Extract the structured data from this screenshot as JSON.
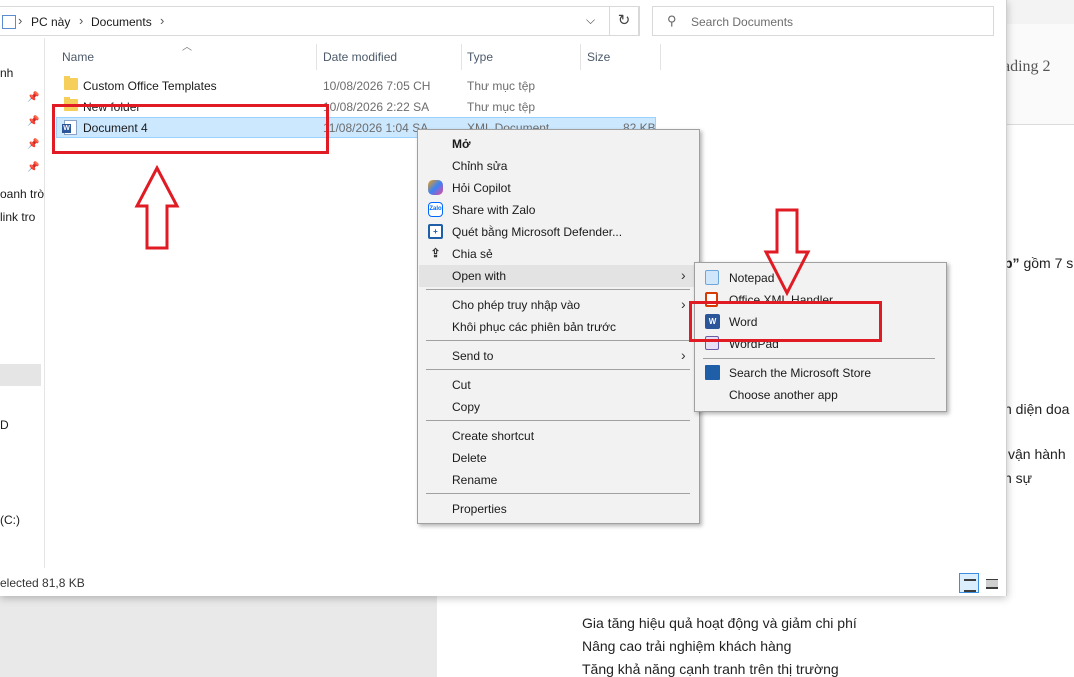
{
  "explorer": {
    "breadcrumb": [
      "PC này",
      "Documents"
    ],
    "search_placeholder": "Search Documents",
    "nav_items": [
      "nh",
      "oanh trò",
      "link tro",
      "D",
      "(C:)"
    ],
    "columns": {
      "name": "Name",
      "date": "Date modified",
      "type": "Type",
      "size": "Size"
    },
    "files": [
      {
        "name": "Custom Office Templates",
        "date": "10/08/2026 7:05 CH",
        "type": "Thư mục tệp",
        "size": "",
        "icon": "folder-icon"
      },
      {
        "name": "New folder",
        "date": "10/08/2026 2:22 SA",
        "type": "Thư mục tệp",
        "size": "",
        "icon": "folder-icon"
      },
      {
        "name": "Document 4",
        "date": "11/08/2026 1:04 SA",
        "type": "XML Document",
        "size": "82 KB",
        "icon": "word-xml-icon"
      }
    ],
    "status": "elected  81,8 KB"
  },
  "context_menu": {
    "items": [
      {
        "label": "Mở",
        "bold": true
      },
      {
        "label": "Chỉnh sửa"
      },
      {
        "label": "Hỏi Copilot",
        "icon": "copilot-icon"
      },
      {
        "label": "Share with Zalo",
        "icon": "zalo-icon"
      },
      {
        "label": "Quét bằng Microsoft Defender...",
        "icon": "defender-icon"
      },
      {
        "label": "Chia sẻ",
        "icon": "share-icon"
      },
      {
        "label": "Open with",
        "submenu": true
      },
      {
        "label": "Cho phép truy nhập vào",
        "submenu": true
      },
      {
        "label": "Khôi phục các phiên bản trước"
      },
      {
        "label": "Send to",
        "submenu": true
      },
      {
        "label": "Cut"
      },
      {
        "label": "Copy"
      },
      {
        "label": "Create shortcut"
      },
      {
        "label": "Delete"
      },
      {
        "label": "Rename"
      },
      {
        "label": "Properties"
      }
    ]
  },
  "open_with_menu": {
    "items": [
      {
        "label": "Notepad",
        "icon": "notepad-icon"
      },
      {
        "label": "Office XML Handler",
        "icon": "office-icon"
      },
      {
        "label": "Word",
        "icon": "word-icon"
      },
      {
        "label": "WordPad",
        "icon": "wordpad-icon"
      },
      {
        "label": "Search the Microsoft Store",
        "icon": "store-icon"
      },
      {
        "label": "Choose another app"
      }
    ]
  },
  "word_background": {
    "heading": "ading 2",
    "frag1": "p” gồm 7 s",
    "frag2": "n diện doa",
    "frag3": "vận hành",
    "frag4": "n sự",
    "lines": [
      "Gia tăng hiệu quả hoạt động và giảm chi phí",
      "Nâng cao trải nghiệm khách hàng",
      "Tăng khả năng cạnh tranh trên thị trường"
    ]
  },
  "colors": {
    "annotation": "#e01b24",
    "selection": "#cce8ff",
    "word_blue": "#2b579a"
  }
}
